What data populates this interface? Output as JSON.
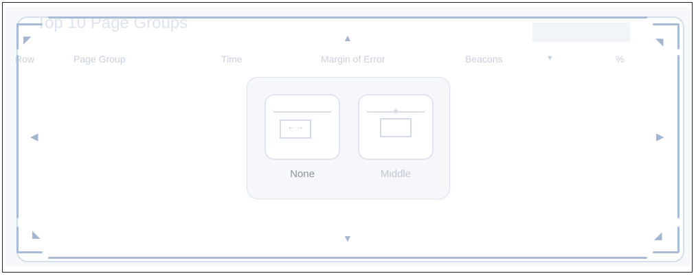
{
  "widget": {
    "title": "Top 10 Page Groups",
    "columns": [
      "Row",
      "Page Group",
      "Time",
      "Margin of Error",
      "Beacons",
      "▼",
      "%"
    ]
  },
  "alignment_picker": {
    "options": [
      {
        "label": "None",
        "arrows": "← →",
        "icon": "no-alignment-icon"
      },
      {
        "label": "Middle",
        "icon": "middle-alignment-icon"
      }
    ]
  },
  "frame": {
    "arrows": {
      "up": "▲",
      "down": "▼",
      "left": "◀",
      "right": "▶"
    },
    "corners": {
      "top_left": "◤",
      "top_right": "◥",
      "bottom_left": "◣",
      "bottom_right": "◢"
    }
  },
  "colors": {
    "frame": "#a9bcd7",
    "faded_text": "#c9d1de",
    "active_label": "#8a929e",
    "inactive_label": "#c2c8d2"
  }
}
